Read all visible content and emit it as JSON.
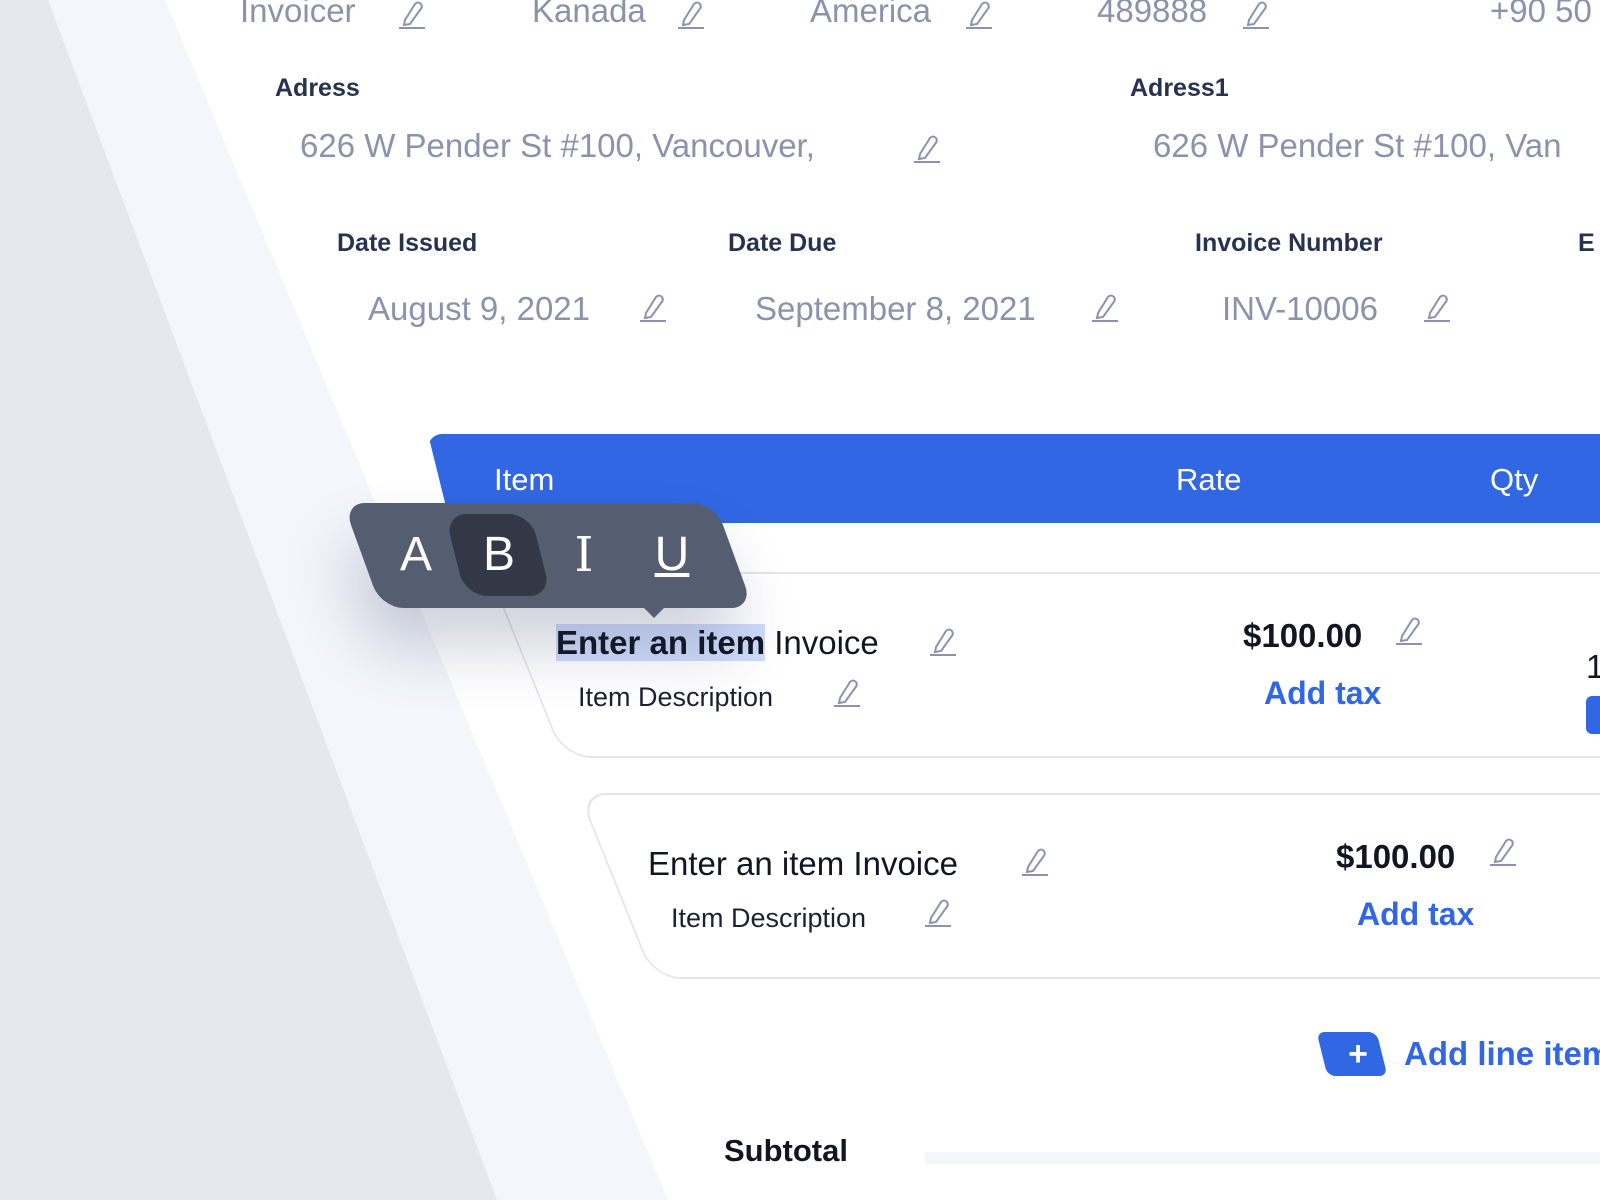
{
  "top_fields": [
    {
      "value": "Invoicer"
    },
    {
      "value": "Kanada"
    },
    {
      "value": "America"
    },
    {
      "value": "489888"
    },
    {
      "value": "+90 50"
    }
  ],
  "address": {
    "label": "Adress",
    "value": "626 W Pender St #100, Vancouver,"
  },
  "address1": {
    "label": "Adress1",
    "value": "626 W Pender St #100, Van"
  },
  "dates": {
    "issued_label": "Date Issued",
    "issued_value": "August 9, 2021",
    "due_label": "Date Due",
    "due_value": "September 8, 2021",
    "invoice_number_label": "Invoice Number",
    "invoice_number_value": "INV-10006",
    "cut_label": "E"
  },
  "table": {
    "columns": [
      "Item",
      "Rate",
      "Qty"
    ]
  },
  "toolbar": {
    "buttons": [
      "A",
      "B",
      "I",
      "U"
    ],
    "active": "B"
  },
  "line_items": [
    {
      "name_selected": "Enter an item",
      "name_rest": " Invoice",
      "description": "Item Description",
      "rate": "$100.00",
      "add_tax": "Add tax",
      "qty_stub": "1"
    },
    {
      "name": "Enter an item Invoice",
      "description": "Item Description",
      "rate": "$100.00",
      "add_tax": "Add tax"
    }
  ],
  "add_line": {
    "plus": "+",
    "label": "Add line item"
  },
  "totals": {
    "subtotal_label": "Subtotal"
  },
  "colors": {
    "accent": "#3167e3",
    "label_dark": "#26324f",
    "value_gray": "#8a93ab",
    "toolbar_bg": "#555d70",
    "toolbar_active": "#333846"
  },
  "icons": {
    "edit": "pencil-edit-icon",
    "plus": "plus-icon"
  }
}
